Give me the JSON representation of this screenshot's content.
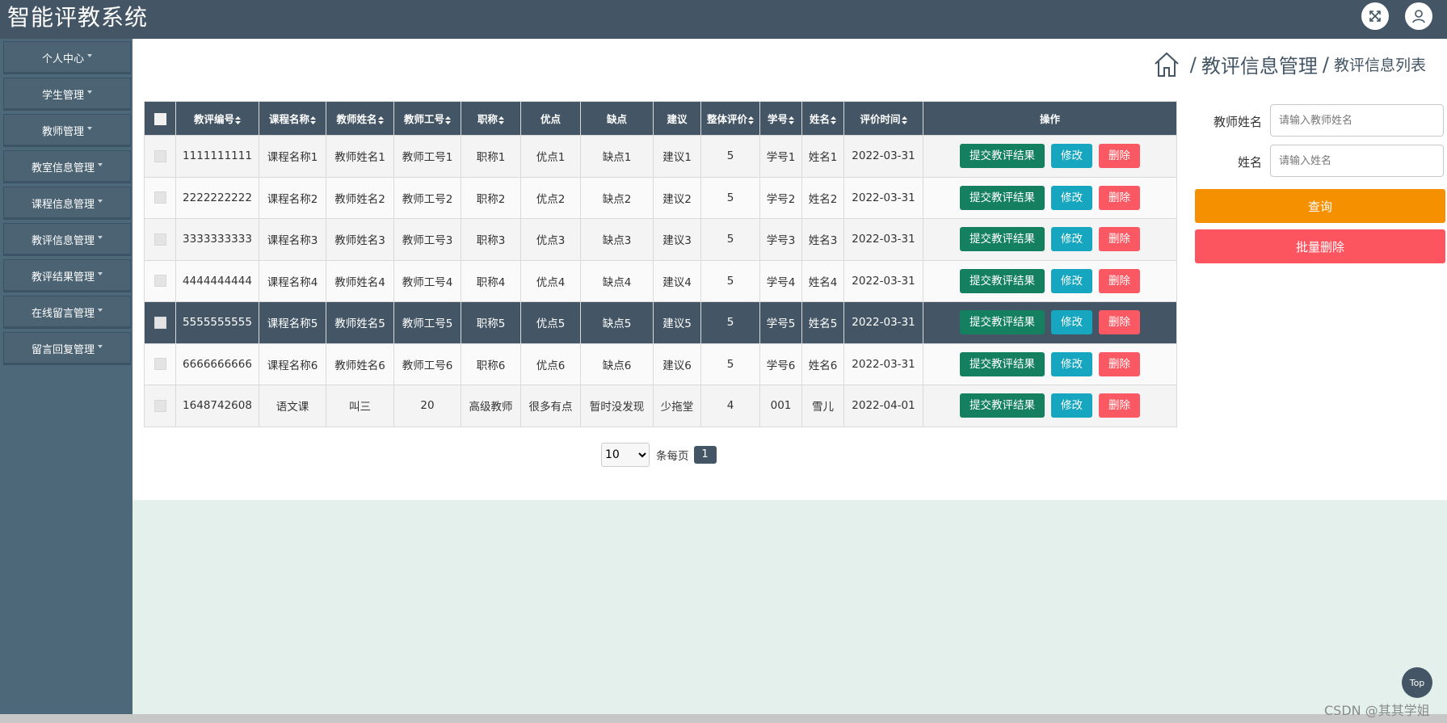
{
  "app": {
    "title": "智能评教系统"
  },
  "header_icons": [
    "fullscreen-icon",
    "user-icon"
  ],
  "sidebar": {
    "items": [
      {
        "label": "个人中心"
      },
      {
        "label": "学生管理"
      },
      {
        "label": "教师管理"
      },
      {
        "label": "教室信息管理"
      },
      {
        "label": "课程信息管理"
      },
      {
        "label": "教评信息管理"
      },
      {
        "label": "教评结果管理"
      },
      {
        "label": "在线留言管理"
      },
      {
        "label": "留言回复管理"
      }
    ]
  },
  "breadcrumb": {
    "level1": "教评信息管理",
    "level2": "教评信息列表",
    "separator": "/"
  },
  "table": {
    "headers": [
      "教评编号",
      "课程名称",
      "教师姓名",
      "教师工号",
      "职称",
      "优点",
      "缺点",
      "建议",
      "整体评价",
      "学号",
      "姓名",
      "评价时间",
      "操作"
    ],
    "rows": [
      [
        "1111111111",
        "课程名称1",
        "教师姓名1",
        "教师工号1",
        "职称1",
        "优点1",
        "缺点1",
        "建议1",
        "5",
        "学号1",
        "姓名1",
        "2022-03-31"
      ],
      [
        "2222222222",
        "课程名称2",
        "教师姓名2",
        "教师工号2",
        "职称2",
        "优点2",
        "缺点2",
        "建议2",
        "5",
        "学号2",
        "姓名2",
        "2022-03-31"
      ],
      [
        "3333333333",
        "课程名称3",
        "教师姓名3",
        "教师工号3",
        "职称3",
        "优点3",
        "缺点3",
        "建议3",
        "5",
        "学号3",
        "姓名3",
        "2022-03-31"
      ],
      [
        "4444444444",
        "课程名称4",
        "教师姓名4",
        "教师工号4",
        "职称4",
        "优点4",
        "缺点4",
        "建议4",
        "5",
        "学号4",
        "姓名4",
        "2022-03-31"
      ],
      [
        "5555555555",
        "课程名称5",
        "教师姓名5",
        "教师工号5",
        "职称5",
        "优点5",
        "缺点5",
        "建议5",
        "5",
        "学号5",
        "姓名5",
        "2022-03-31"
      ],
      [
        "6666666666",
        "课程名称6",
        "教师姓名6",
        "教师工号6",
        "职称6",
        "优点6",
        "缺点6",
        "建议6",
        "5",
        "学号6",
        "姓名6",
        "2022-03-31"
      ],
      [
        "1648742608",
        "语文课",
        "叫三",
        "20",
        "高级教师",
        "很多有点",
        "暂时没发现",
        "少拖堂",
        "4",
        "001",
        "雪儿",
        "2022-04-01"
      ]
    ],
    "selected_row": 4,
    "actions": {
      "submit": "提交教评结果",
      "edit": "修改",
      "delete": "删除"
    }
  },
  "search": {
    "teacher_name_label": "教师姓名",
    "teacher_name_placeholder": "请输入教师姓名",
    "name_label": "姓名",
    "name_placeholder": "请输入姓名",
    "query_button": "查询",
    "batch_delete_button": "批量删除"
  },
  "pagination": {
    "page_size": "10",
    "per_page_text": "条每页",
    "current_page": "1"
  },
  "top_button": "Top",
  "watermark": "CSDN @其其学姐",
  "colors": {
    "header_bg": "#445665",
    "sidebar_bg": "#4d6878",
    "submit_btn": "#14805f",
    "edit_btn": "#16a6bf",
    "delete_btn": "#fa5862",
    "query_btn": "#f59000",
    "batch_delete_btn": "#fc5560",
    "footer_bg": "#e4f0ec"
  }
}
